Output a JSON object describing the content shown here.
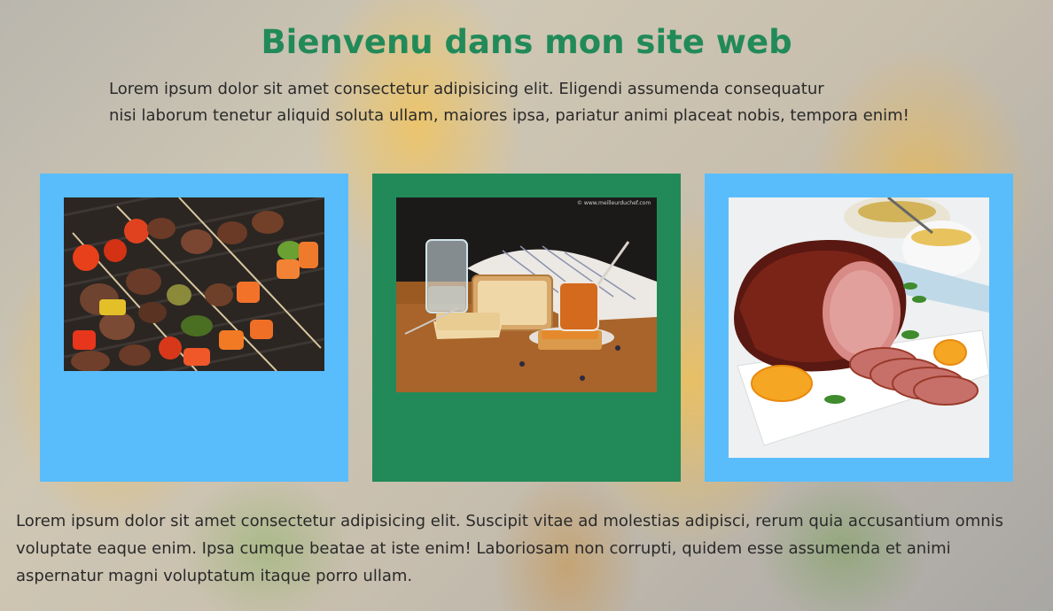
{
  "header": {
    "title": "Bienvenu dans mon site web",
    "intro_line1": "Lorem ipsum dolor sit amet consectetur adipisicing elit. Eligendi assumenda consequatur",
    "intro_line2": "nisi laborum tenetur aliquid soluta ullam, maiores ipsa, pariatur animi placeat nobis, tempora enim!"
  },
  "cards": [
    {
      "image": "brochettes-grill-photo",
      "background": "#59bdfb"
    },
    {
      "image": "pain-confiture-photo",
      "background": "#228a59",
      "watermark": "© www.meilleurduchef.com"
    },
    {
      "image": "jambon-roti-photo",
      "background": "#59bdfb"
    }
  ],
  "footer": {
    "text": "Lorem ipsum dolor sit amet consectetur adipisicing elit. Suscipit vitae ad molestias adipisci, rerum quia accusantium omnis voluptate eaque enim. Ipsa cumque beatae at iste enim! Laboriosam non corrupti, quidem esse assumenda et animi aspernatur magni voluptatum itaque porro ullam."
  },
  "colors": {
    "title": "#228a59",
    "card_blue": "#59bdfb",
    "card_green": "#228a59"
  }
}
